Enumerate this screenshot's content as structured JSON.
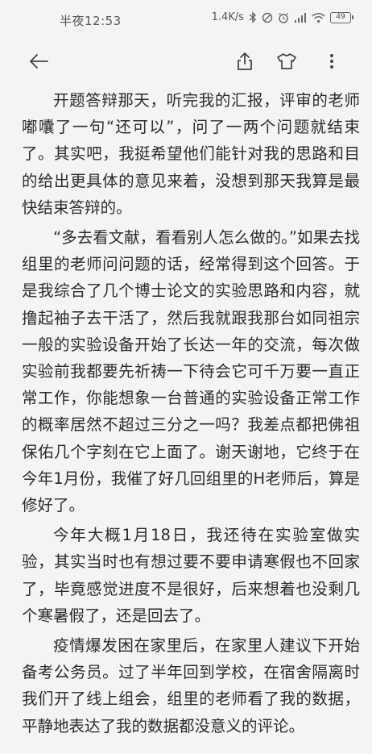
{
  "status_bar": {
    "time": "半夜12:53",
    "network_speed": "1.4K/s",
    "battery": "49",
    "icons": [
      "bluetooth-icon",
      "mute-icon",
      "alarm-icon",
      "signal-icon",
      "wifi-icon",
      "battery-icon"
    ]
  },
  "toolbar": {
    "icons": [
      "back-arrow-icon",
      "share-icon",
      "tshirt-icon",
      "more-vertical-icon"
    ]
  },
  "article": {
    "paragraphs": [
      "开题答辩那天，听完我的汇报，评审的老师嘟囔了一句“还可以”，问了一两个问题就结束了。其实吧，我挺希望他们能针对我的思路和目的给出更具体的意见来着，没想到那天我算是最快结束答辩的。",
      "“多去看文献，看看别人怎么做的。”如果去找组里的老师问问题的话，经常得到这个回答。于是我综合了几个博士论文的实验思路和内容，就撸起袖子去干活了，然后我就跟我那台如同祖宗一般的实验设备开始了长达一年的交流，每次做实验前我都要先祈祷一下待会它可千万要一直正常工作，你能想象一台普通的实验设备正常工作的概率居然不超过三分之一吗？我差点都把佛祖保佑几个字刻在它上面了。谢天谢地，它终于在今年1月份，我催了好几回组里的H老师后，算是修好了。",
      "今年大概1月18日，我还待在实验室做实验，其实当时也有想过要不要申请寒假也不回家了，毕竟感觉进度不是很好，后来想着也没剩几个寒暑假了，还是回去了。",
      "疫情爆发困在家里后，在家里人建议下开始备考公务员。过了半年回到学校，在宿舍隔离时我们开了线上组会，组里的老师看了我的数据，平静地表达了我的数据都没意义的评论。"
    ]
  }
}
